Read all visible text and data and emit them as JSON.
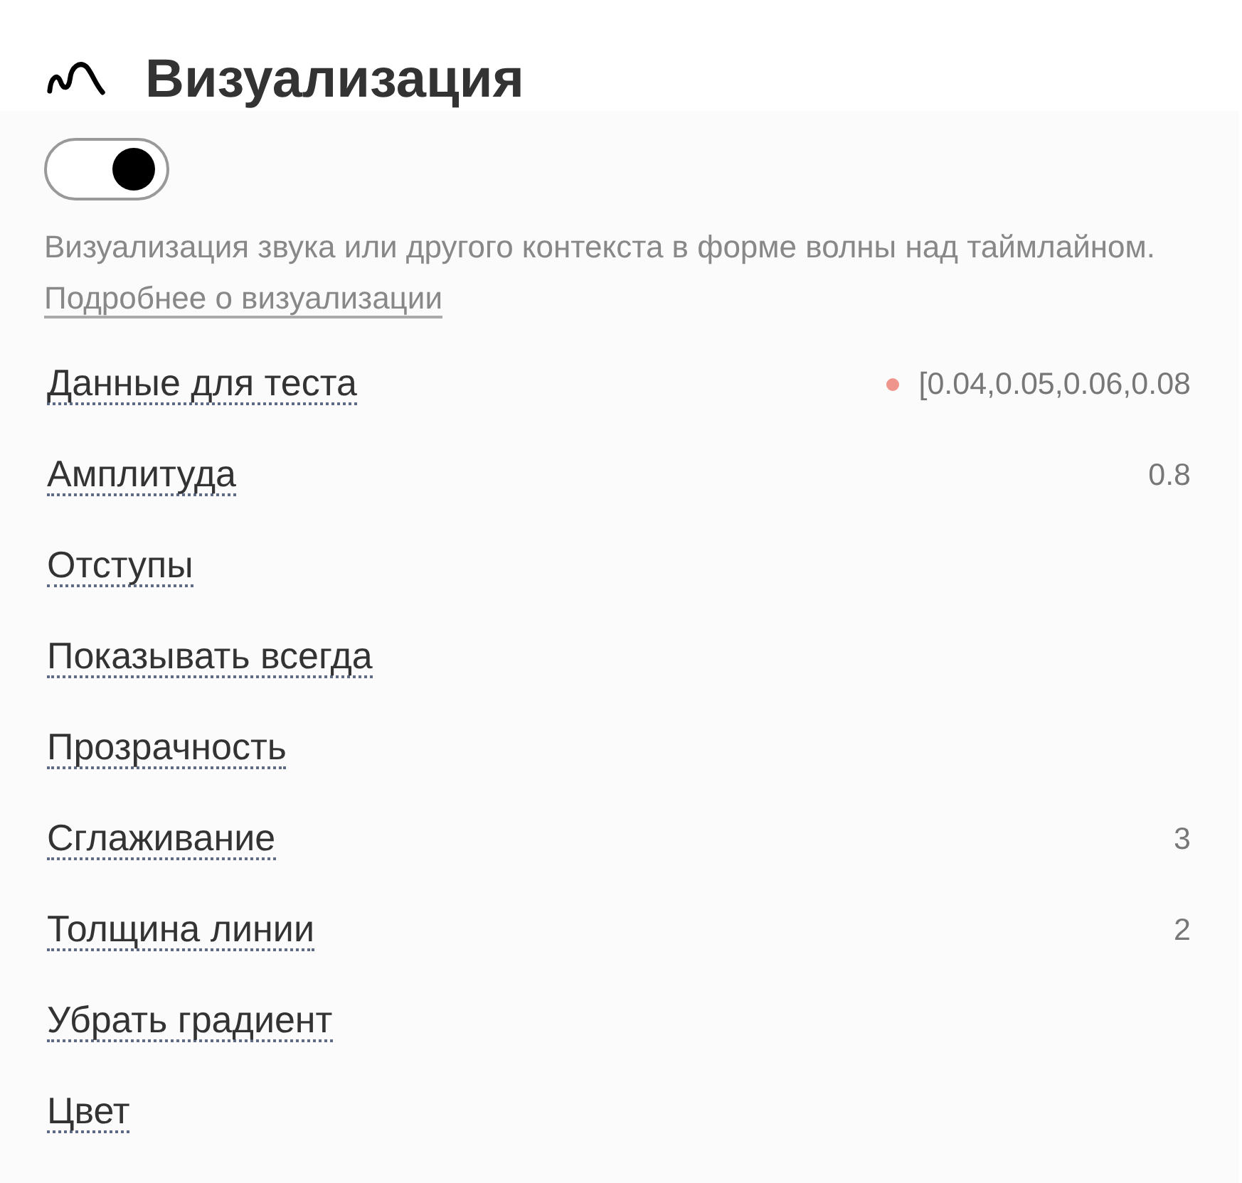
{
  "header": {
    "title": "Визуализация"
  },
  "toggle": {
    "on": true
  },
  "description": "Визуализация звука или другого контекста в форме волны над таймлайном.",
  "link": "Подробнее о визуализации",
  "rows": [
    {
      "label": "Данные для теста",
      "value": "[0.04,0.05,0.06,0.08",
      "color": "#f0958c"
    },
    {
      "label": "Амплитуда",
      "value": "0.8"
    },
    {
      "label": "Отступы"
    },
    {
      "label": "Показывать всегда"
    },
    {
      "label": "Прозрачность"
    },
    {
      "label": "Сглаживание",
      "value": "3"
    },
    {
      "label": "Толщина линии",
      "value": "2"
    },
    {
      "label": "Убрать градиент"
    },
    {
      "label": "Цвет"
    }
  ]
}
